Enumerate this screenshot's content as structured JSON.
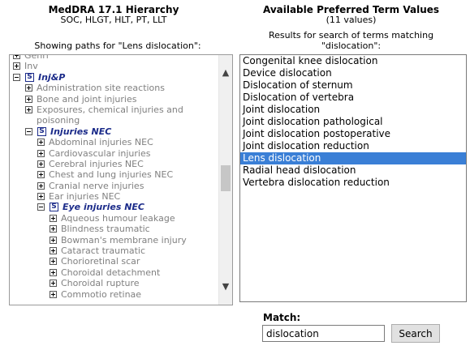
{
  "left_header": {
    "title": "MedDRA 17.1 Hierarchy",
    "subtitle": "SOC, HLGT, HLT, PT, LLT",
    "caption": "Showing paths for \"Lens dislocation\":"
  },
  "right_header": {
    "title": "Available Preferred Term Values",
    "subtitle": "(11 values)",
    "caption_line1": "Results for search of terms matching",
    "caption_line2": "\"dislocation\":"
  },
  "tree": {
    "items": [
      {
        "label": "Genrl",
        "level": 0,
        "toggle": "plus",
        "badge": ""
      },
      {
        "label": "Inv",
        "level": 0,
        "toggle": "plus",
        "badge": ""
      },
      {
        "label": "Inj&P",
        "level": 0,
        "toggle": "minus",
        "badge": "S"
      },
      {
        "label": "Administration site reactions",
        "level": 1,
        "toggle": "plus",
        "badge": ""
      },
      {
        "label": "Bone and joint injuries",
        "level": 1,
        "toggle": "plus",
        "badge": ""
      },
      {
        "label": "Exposures, chemical injuries and poisoning",
        "level": 1,
        "toggle": "plus",
        "badge": ""
      },
      {
        "label": "Injuries NEC",
        "level": 1,
        "toggle": "minus",
        "badge": "S"
      },
      {
        "label": "Abdominal injuries NEC",
        "level": 2,
        "toggle": "plus",
        "badge": ""
      },
      {
        "label": "Cardiovascular injuries",
        "level": 2,
        "toggle": "plus",
        "badge": ""
      },
      {
        "label": "Cerebral injuries NEC",
        "level": 2,
        "toggle": "plus",
        "badge": ""
      },
      {
        "label": "Chest and lung injuries NEC",
        "level": 2,
        "toggle": "plus",
        "badge": ""
      },
      {
        "label": "Cranial nerve injuries",
        "level": 2,
        "toggle": "plus",
        "badge": ""
      },
      {
        "label": "Ear injuries NEC",
        "level": 2,
        "toggle": "plus",
        "badge": ""
      },
      {
        "label": "Eye injuries NEC",
        "level": 2,
        "toggle": "minus",
        "badge": "S"
      },
      {
        "label": "Aqueous humour leakage",
        "level": 3,
        "toggle": "plus",
        "badge": ""
      },
      {
        "label": "Blindness traumatic",
        "level": 3,
        "toggle": "plus",
        "badge": ""
      },
      {
        "label": "Bowman's membrane injury",
        "level": 3,
        "toggle": "plus",
        "badge": ""
      },
      {
        "label": "Cataract traumatic",
        "level": 3,
        "toggle": "plus",
        "badge": ""
      },
      {
        "label": "Chorioretinal scar",
        "level": 3,
        "toggle": "plus",
        "badge": ""
      },
      {
        "label": "Choroidal detachment",
        "level": 3,
        "toggle": "plus",
        "badge": ""
      },
      {
        "label": "Choroidal rupture",
        "level": 3,
        "toggle": "plus",
        "badge": ""
      },
      {
        "label": "Commotio retinae",
        "level": 3,
        "toggle": "plus",
        "badge": ""
      }
    ],
    "scroll_up_icon": "▲",
    "scroll_down_icon": "▼"
  },
  "results": {
    "items": [
      "Congenital knee dislocation",
      "Device dislocation",
      "Dislocation of sternum",
      "Dislocation of vertebra",
      "Joint dislocation",
      "Joint dislocation pathological",
      "Joint dislocation postoperative",
      "Joint dislocation reduction",
      "Lens dislocation",
      "Radial head dislocation",
      "Vertebra dislocation reduction"
    ],
    "selected_index": 8,
    "selected_color": "#3a7fd6"
  },
  "match": {
    "label": "Match:",
    "value": "dislocation",
    "button_label": "Search"
  }
}
